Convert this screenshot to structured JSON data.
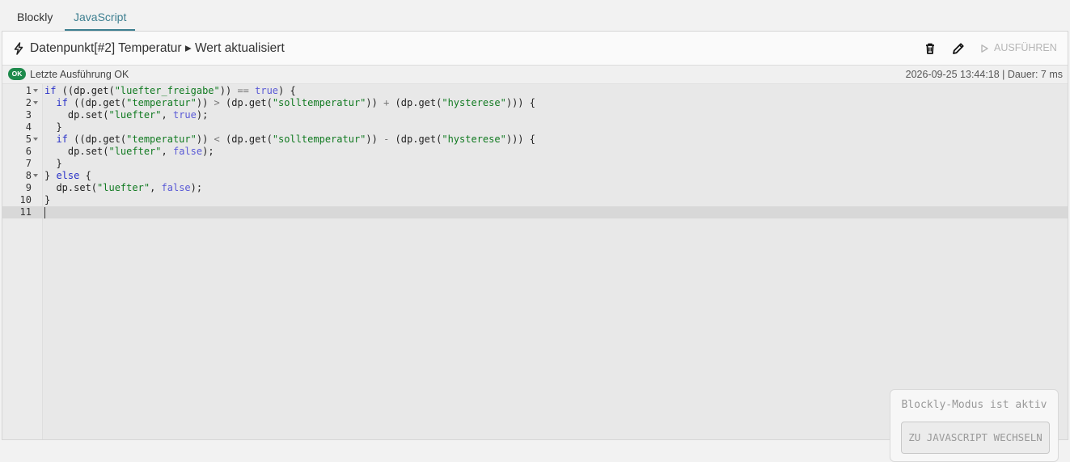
{
  "tabs": [
    {
      "label": "Blockly",
      "active": false
    },
    {
      "label": "JavaScript",
      "active": true
    }
  ],
  "header": {
    "title": "Datenpunkt[#2] Temperatur ▸ Wert aktualisiert",
    "run_label": "AUSFÜHREN",
    "icons": [
      "lightning-icon",
      "trash-icon",
      "pencil-icon",
      "play-icon"
    ]
  },
  "status": {
    "badge": "OK",
    "message": "Letzte Ausführung OK",
    "timestamp": "2026-09-25 13:44:18",
    "separator": " | ",
    "duration": "Dauer: 7 ms"
  },
  "code": {
    "active_line": 11,
    "lines": [
      {
        "n": "1",
        "fold": true
      },
      {
        "n": "2",
        "fold": true
      },
      {
        "n": "3",
        "fold": false
      },
      {
        "n": "4",
        "fold": false
      },
      {
        "n": "5",
        "fold": true
      },
      {
        "n": "6",
        "fold": false
      },
      {
        "n": "7",
        "fold": false
      },
      {
        "n": "8",
        "fold": true
      },
      {
        "n": "9",
        "fold": false
      },
      {
        "n": "10",
        "fold": false
      },
      {
        "n": "11",
        "fold": false
      }
    ],
    "tokens": [
      [
        [
          "kw",
          "if"
        ],
        [
          "p",
          " ((dp.get("
        ],
        [
          "str",
          "\"luefter_freigabe\""
        ],
        [
          "p",
          ")) "
        ],
        [
          "op",
          "=="
        ],
        [
          "p",
          " "
        ],
        [
          "bool",
          "true"
        ],
        [
          "p",
          ") {"
        ]
      ],
      [
        [
          "p",
          "  "
        ],
        [
          "kw",
          "if"
        ],
        [
          "p",
          " ((dp.get("
        ],
        [
          "str",
          "\"temperatur\""
        ],
        [
          "p",
          ")) "
        ],
        [
          "op",
          ">"
        ],
        [
          "p",
          " (dp.get("
        ],
        [
          "str",
          "\"solltemperatur\""
        ],
        [
          "p",
          ")) "
        ],
        [
          "op",
          "+"
        ],
        [
          "p",
          " (dp.get("
        ],
        [
          "str",
          "\"hysterese\""
        ],
        [
          "p",
          "))) {"
        ]
      ],
      [
        [
          "p",
          "    dp.set("
        ],
        [
          "str",
          "\"luefter\""
        ],
        [
          "p",
          ", "
        ],
        [
          "bool",
          "true"
        ],
        [
          "p",
          ");"
        ]
      ],
      [
        [
          "p",
          "  }"
        ]
      ],
      [
        [
          "p",
          "  "
        ],
        [
          "kw",
          "if"
        ],
        [
          "p",
          " ((dp.get("
        ],
        [
          "str",
          "\"temperatur\""
        ],
        [
          "p",
          ")) "
        ],
        [
          "op",
          "<"
        ],
        [
          "p",
          " (dp.get("
        ],
        [
          "str",
          "\"solltemperatur\""
        ],
        [
          "p",
          ")) "
        ],
        [
          "op",
          "-"
        ],
        [
          "p",
          " (dp.get("
        ],
        [
          "str",
          "\"hysterese\""
        ],
        [
          "p",
          "))) {"
        ]
      ],
      [
        [
          "p",
          "    dp.set("
        ],
        [
          "str",
          "\"luefter\""
        ],
        [
          "p",
          ", "
        ],
        [
          "bool",
          "false"
        ],
        [
          "p",
          ");"
        ]
      ],
      [
        [
          "p",
          "  }"
        ]
      ],
      [
        [
          "p",
          "} "
        ],
        [
          "kw",
          "else"
        ],
        [
          "p",
          " {"
        ]
      ],
      [
        [
          "p",
          "  dp.set("
        ],
        [
          "str",
          "\"luefter\""
        ],
        [
          "p",
          ", "
        ],
        [
          "bool",
          "false"
        ],
        [
          "p",
          ");"
        ]
      ],
      [
        [
          "p",
          "}"
        ]
      ],
      []
    ]
  },
  "overlay": {
    "label": "Blockly-Modus ist aktiv",
    "button": "ZU JAVASCRIPT WECHSELN"
  },
  "colors": {
    "accent": "#3d7f90",
    "ok_badge": "#1e8a4c",
    "keyword": "#2a32c8",
    "string": "#117a21"
  }
}
